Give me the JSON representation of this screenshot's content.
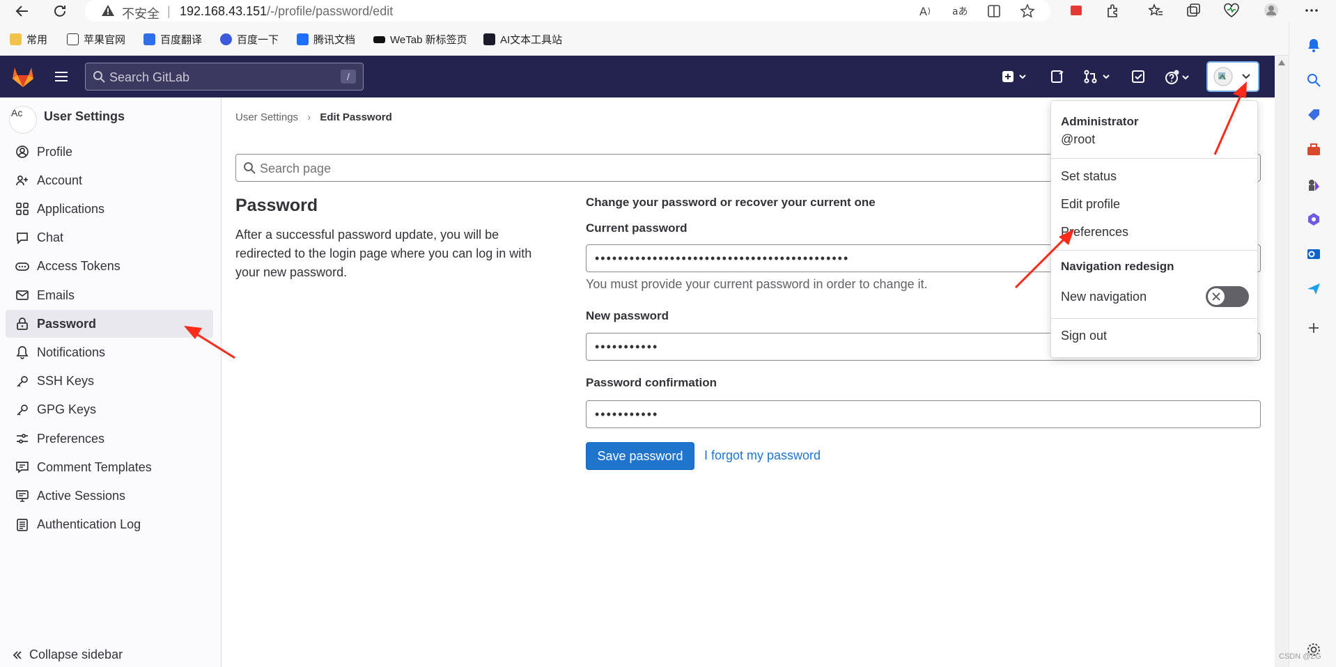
{
  "browser": {
    "insecure_label": "不安全",
    "url_host": "192.168.43.151",
    "url_path": "/-/profile/password/edit",
    "bookmarks": [
      "常用",
      "苹果官网",
      "百度翻译",
      "百度一下",
      "腾讯文档",
      "WeTab 新标签页",
      "AI文本工具站"
    ]
  },
  "header": {
    "search_placeholder": "Search GitLab",
    "search_shortcut": "/"
  },
  "sidebar": {
    "title": "User Settings",
    "avatar_alt": "Ac",
    "items": [
      {
        "label": "Profile",
        "icon": "profile-icon"
      },
      {
        "label": "Account",
        "icon": "account-icon"
      },
      {
        "label": "Applications",
        "icon": "applications-icon"
      },
      {
        "label": "Chat",
        "icon": "chat-icon"
      },
      {
        "label": "Access Tokens",
        "icon": "token-icon"
      },
      {
        "label": "Emails",
        "icon": "mail-icon"
      },
      {
        "label": "Password",
        "icon": "lock-icon",
        "active": true
      },
      {
        "label": "Notifications",
        "icon": "bell-icon"
      },
      {
        "label": "SSH Keys",
        "icon": "key-icon"
      },
      {
        "label": "GPG Keys",
        "icon": "key-icon"
      },
      {
        "label": "Preferences",
        "icon": "preferences-icon"
      },
      {
        "label": "Comment Templates",
        "icon": "comment-icon"
      },
      {
        "label": "Active Sessions",
        "icon": "monitor-icon"
      },
      {
        "label": "Authentication Log",
        "icon": "log-icon"
      }
    ],
    "collapse_label": "Collapse sidebar"
  },
  "main": {
    "breadcrumb": {
      "parent": "User Settings",
      "current": "Edit Password"
    },
    "search_placeholder": "Search page",
    "heading": "Password",
    "description": "After a successful password update, you will be redirected to the login page where you can log in with your new password.",
    "form_title": "Change your password or recover your current one",
    "current_password_label": "Current password",
    "current_password_value": "••••••••••••••••••••••••••••••••••••••••••••",
    "current_password_hint": "You must provide your current password in order to change it.",
    "new_password_label": "New password",
    "new_password_value": "•••••••••••",
    "confirm_password_label": "Password confirmation",
    "confirm_password_value": "•••••••••••",
    "save_label": "Save password",
    "forgot_label": "I forgot my password"
  },
  "user_menu": {
    "name": "Administrator",
    "username": "@root",
    "set_status": "Set status",
    "edit_profile": "Edit profile",
    "preferences": "Preferences",
    "nav_redesign_title": "Navigation redesign",
    "new_navigation": "New navigation",
    "new_navigation_enabled": false,
    "sign_out": "Sign out"
  },
  "watermark": "CSDN @ZG",
  "colors": {
    "header_bg": "#24224e",
    "primary": "#1f75cb",
    "annotation_arrow": "#ff2a1a"
  }
}
